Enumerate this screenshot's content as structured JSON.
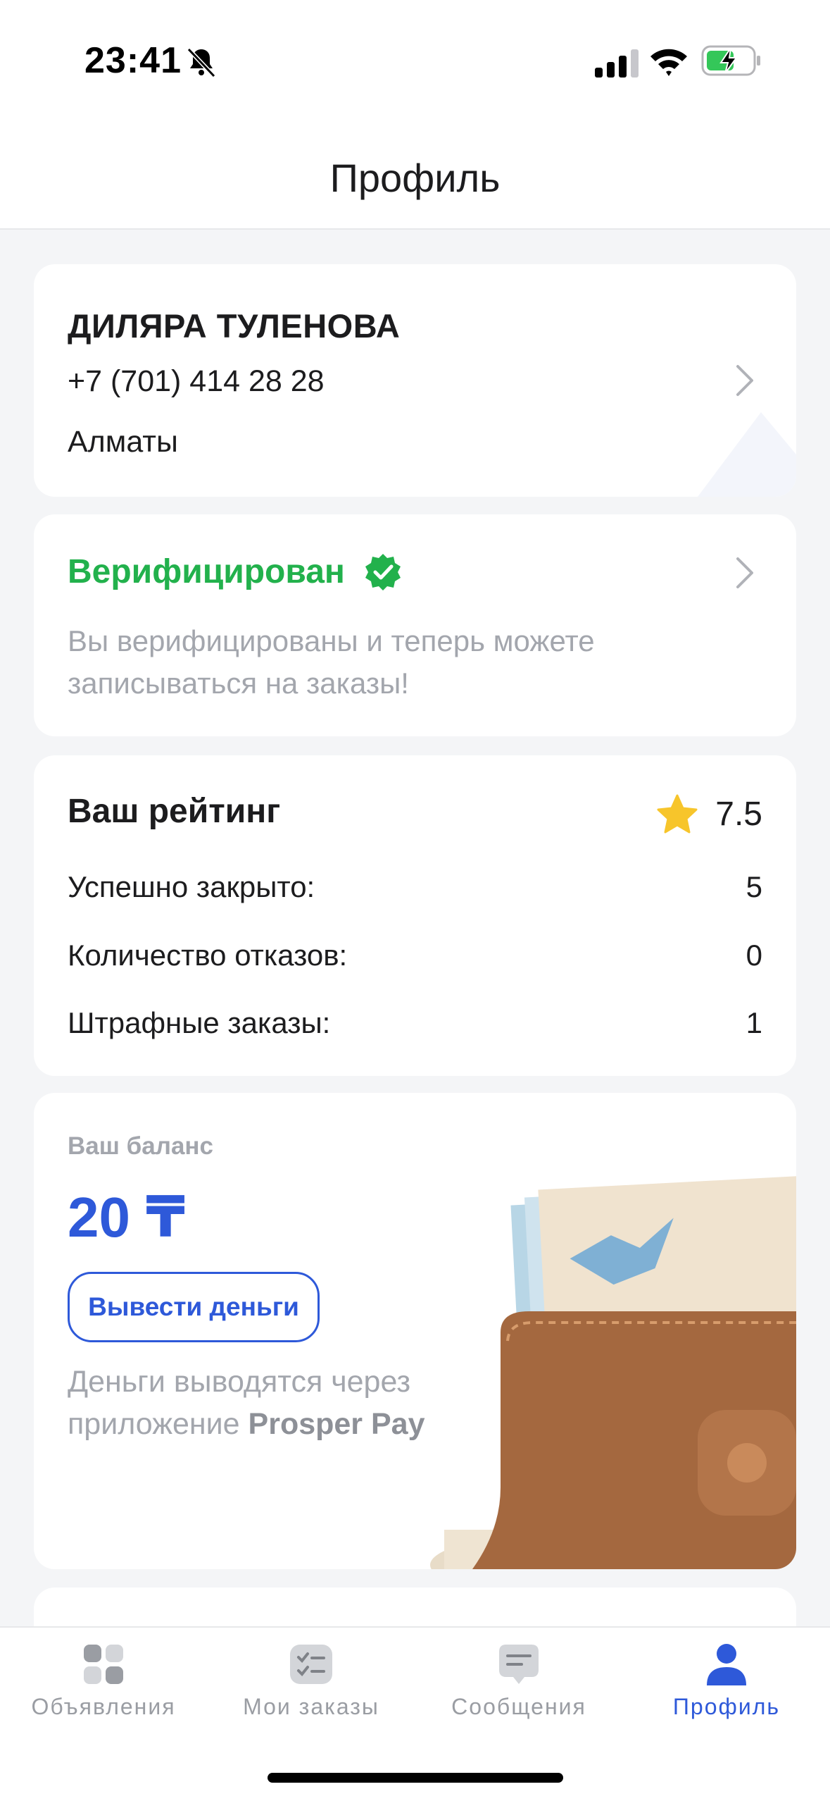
{
  "status_bar": {
    "time": "23:41"
  },
  "header": {
    "title": "Профиль"
  },
  "user": {
    "name": "ДИЛЯРА ТУЛЕНОВА",
    "phone": "+7 (701) 414 28 28",
    "city": "Алматы"
  },
  "verification": {
    "title": "Верифицирован",
    "description": "Вы верифицированы и теперь можете записываться на заказы!",
    "color": "#22b14c"
  },
  "rating": {
    "title": "Ваш рейтинг",
    "value": "7.5",
    "stats": [
      {
        "label": "Успешно закрыто:",
        "value": "5"
      },
      {
        "label": "Количество отказов:",
        "value": "0"
      },
      {
        "label": "Штрафные заказы:",
        "value": "1"
      }
    ]
  },
  "balance": {
    "label": "Ваш баланс",
    "value": "20 ₸",
    "withdraw_label": "Вывести деньги",
    "note_prefix": "Деньги выводятся через приложение ",
    "note_bold": "Prosper Pay",
    "accent": "#2e59d9"
  },
  "tabs": [
    {
      "label": "Объявления",
      "icon": "grid-icon",
      "active": false
    },
    {
      "label": "Мои заказы",
      "icon": "checklist-icon",
      "active": false
    },
    {
      "label": "Сообщения",
      "icon": "chat-icon",
      "active": false
    },
    {
      "label": "Профиль",
      "icon": "profile-icon",
      "active": true
    }
  ]
}
